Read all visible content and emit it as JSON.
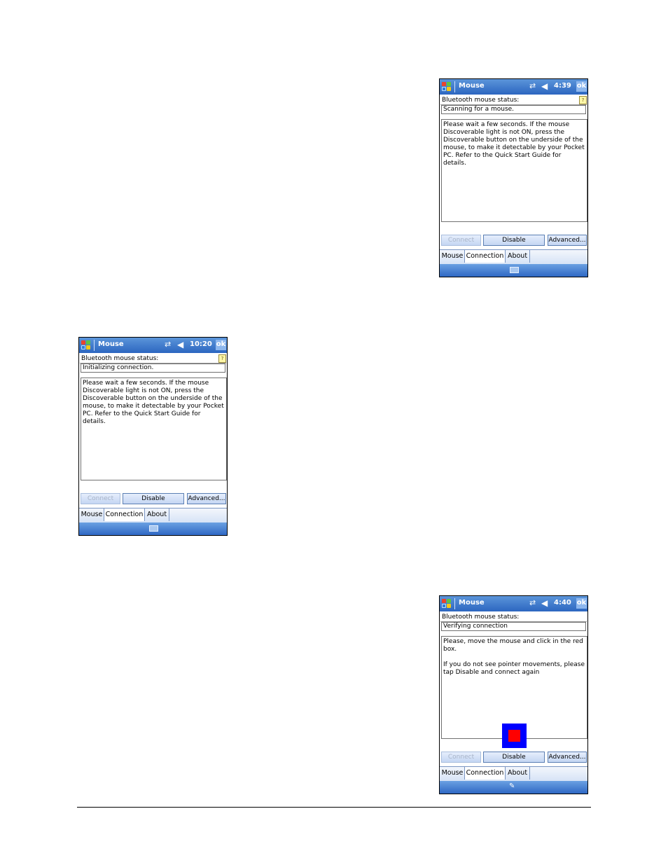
{
  "screens": [
    {
      "app_title": "Mouse",
      "clock": "4:39",
      "ok_label": "ok",
      "status_label": "Bluetooth mouse status:",
      "status_value": "Scanning for a mouse.",
      "message": [
        "Please wait a few seconds. If the mouse Discoverable light is not ON, press the Discoverable button on the underside of the mouse, to make it detectable by your Pocket PC. Refer to the Quick Start Guide for details."
      ],
      "buttons": {
        "connect": "Connect",
        "disable": "Disable",
        "advanced": "Advanced..."
      },
      "tabs": {
        "mouse": "Mouse",
        "connection": "Connection",
        "about": "About"
      },
      "bottom_icon": "keyboard-icon"
    },
    {
      "app_title": "Mouse",
      "clock": "10:20",
      "ok_label": "ok",
      "status_label": "Bluetooth mouse status:",
      "status_value": "Initializing connection.",
      "message": [
        "Please wait a few seconds. If the mouse Discoverable light is not ON, press the Discoverable button on the underside of the mouse, to make it detectable by your Pocket PC. Refer to the Quick Start Guide for details."
      ],
      "buttons": {
        "connect": "Connect",
        "disable": "Disable",
        "advanced": "Advanced..."
      },
      "tabs": {
        "mouse": "Mouse",
        "connection": "Connection",
        "about": "About"
      },
      "bottom_icon": "keyboard-icon"
    },
    {
      "app_title": "Mouse",
      "clock": "4:40",
      "ok_label": "ok",
      "status_label": "Bluetooth mouse status:",
      "status_value": "Verifying connection",
      "message": [
        "Please, move the mouse and click in the red box.",
        "If you do not see pointer movements, please tap Disable and connect again"
      ],
      "buttons": {
        "connect": "Connect",
        "disable": "Disable",
        "advanced": "Advanced..."
      },
      "tabs": {
        "mouse": "Mouse",
        "connection": "Connection",
        "about": "About"
      },
      "bottom_icon": "pen-input-icon"
    }
  ],
  "icons": {
    "start": "windows-start-icon",
    "sync": "sync-arrows-icon",
    "volume": "speaker-muted-icon",
    "help": "help-icon"
  },
  "colors": {
    "titlebar": "#2c66c0",
    "target_outer": "#0000ff",
    "target_inner": "#ff0000"
  }
}
